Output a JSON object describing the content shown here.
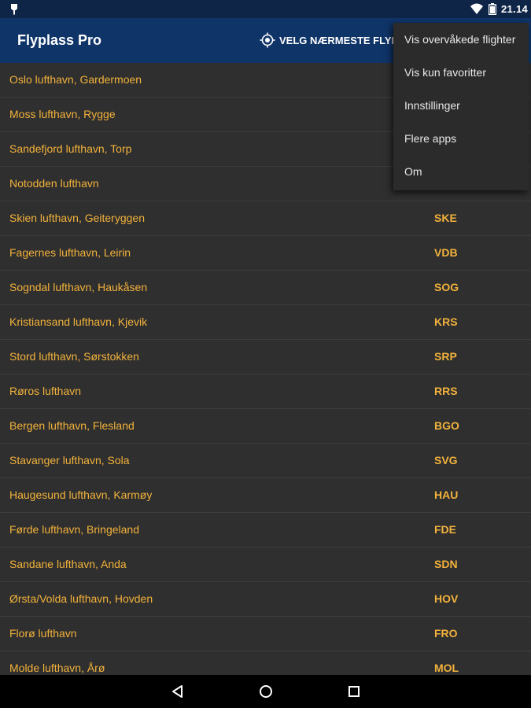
{
  "status_bar": {
    "time": "21.14",
    "icons": [
      "notification-icon",
      "wifi-icon",
      "battery-icon"
    ]
  },
  "toolbar": {
    "title": "Flyplass Pro",
    "nearest_label": "VELG NÆRMESTE FLYPLASS",
    "nearest_icon": "gps-fixed-icon",
    "background": "#0f3468"
  },
  "menu": {
    "items": [
      {
        "label": "Vis overvåkede flighter"
      },
      {
        "label": "Vis kun favoritter"
      },
      {
        "label": "Innstillinger"
      },
      {
        "label": "Flere apps"
      },
      {
        "label": "Om"
      }
    ]
  },
  "airports": [
    {
      "name": "Oslo lufthavn, Gardermoen",
      "code": ""
    },
    {
      "name": "Moss lufthavn, Rygge",
      "code": ""
    },
    {
      "name": "Sandefjord lufthavn, Torp",
      "code": ""
    },
    {
      "name": "Notodden lufthavn",
      "code": ""
    },
    {
      "name": "Skien lufthavn, Geiteryggen",
      "code": "SKE"
    },
    {
      "name": "Fagernes lufthavn, Leirin",
      "code": "VDB"
    },
    {
      "name": "Sogndal lufthavn, Haukåsen",
      "code": "SOG"
    },
    {
      "name": "Kristiansand lufthavn, Kjevik",
      "code": "KRS"
    },
    {
      "name": "Stord lufthavn, Sørstokken",
      "code": "SRP"
    },
    {
      "name": "Røros lufthavn",
      "code": "RRS"
    },
    {
      "name": "Bergen lufthavn, Flesland",
      "code": "BGO"
    },
    {
      "name": "Stavanger lufthavn, Sola",
      "code": "SVG"
    },
    {
      "name": "Haugesund lufthavn, Karmøy",
      "code": "HAU"
    },
    {
      "name": "Førde lufthavn, Bringeland",
      "code": "FDE"
    },
    {
      "name": "Sandane lufthavn, Anda",
      "code": "SDN"
    },
    {
      "name": "Ørsta/Volda lufthavn, Hovden",
      "code": "HOV"
    },
    {
      "name": "Florø lufthavn",
      "code": "FRO"
    },
    {
      "name": "Molde lufthavn, Årø",
      "code": "MOL"
    }
  ],
  "colors": {
    "accent_text": "#f2b23b",
    "list_background": "#2f2f2f",
    "status_bar": "#0f2548"
  },
  "nav_bar": {
    "icons": [
      "back-icon",
      "home-icon",
      "recents-icon"
    ]
  }
}
